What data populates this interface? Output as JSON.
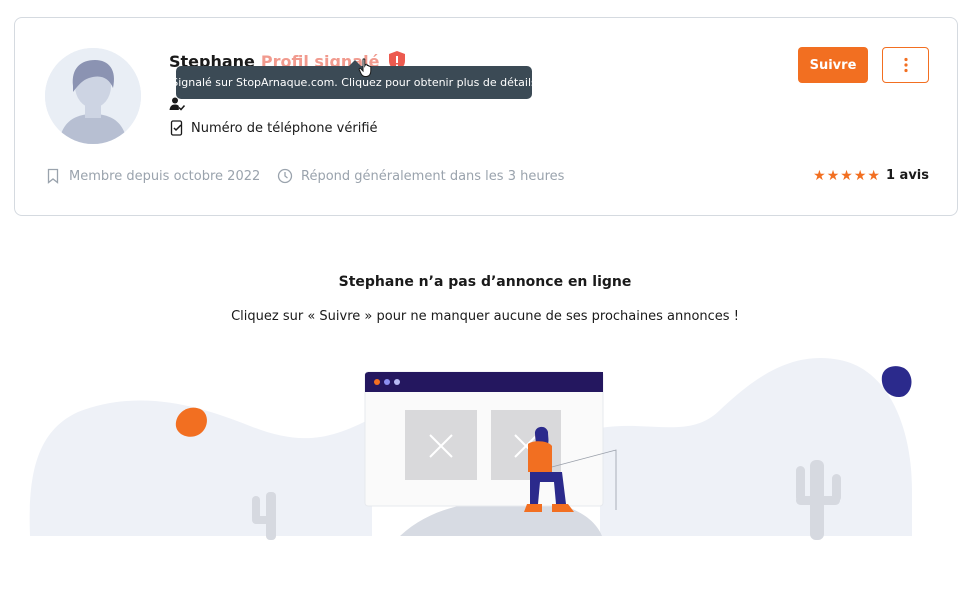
{
  "profile": {
    "name": "Stephane",
    "flag_label": "Profil signalé",
    "tooltip": "Signalé sur StopArnaque.com. Cliquez pour obtenir plus de détails",
    "phone_verified": "Numéro de téléphone vérifié",
    "member_since": "Membre depuis octobre 2022",
    "response_time": "Répond généralement dans les 3 heures",
    "rating": {
      "stars": 5,
      "max": 5,
      "count_label": "1 avis"
    },
    "icons": {
      "flag": "alert-shield-icon",
      "cursor": "hand-pointer-icon",
      "identity": "user-check-icon",
      "phone": "phone-check-icon",
      "member": "bookmark-icon",
      "response": "clock-icon",
      "more": "vertical-dots-icon"
    }
  },
  "actions": {
    "follow_label": "Suivre"
  },
  "empty_state": {
    "title": "Stephane n’a pas d’annonce en ligne",
    "subtitle": "Cliquez sur « Suivre » pour ne manquer aucune de ses prochaines annonces !"
  },
  "colors": {
    "accent": "#f26f21",
    "flag": "#f19a8e",
    "alert": "#ec5a4f",
    "tooltip_bg": "#3b4a55",
    "muted": "#9aa3ad",
    "illustration_navy": "#2b2a8c"
  }
}
